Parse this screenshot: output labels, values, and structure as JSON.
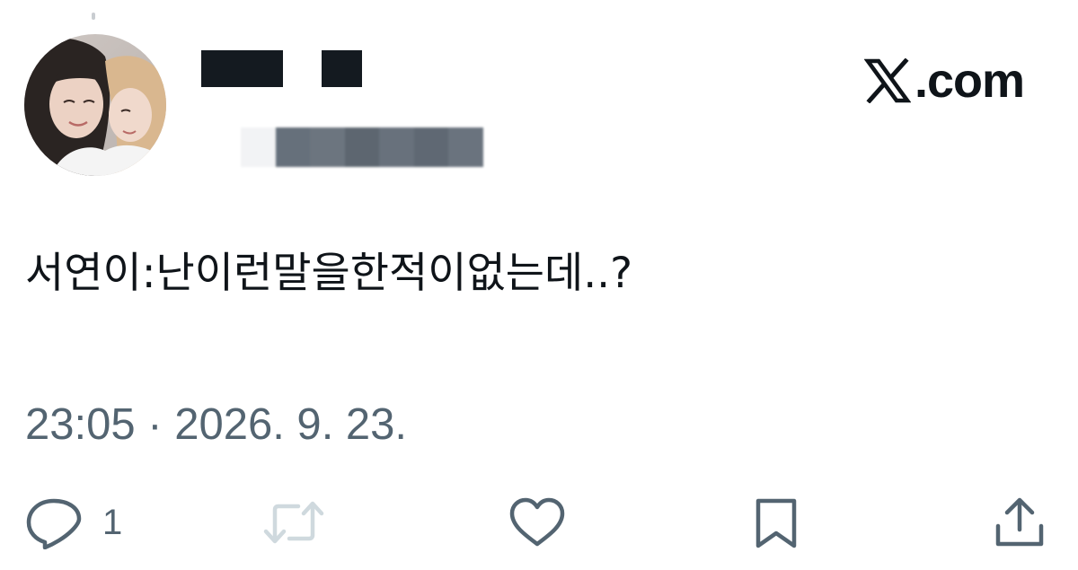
{
  "author": {
    "avatar_alt": "profile photo",
    "name_redacted": true,
    "handle_redacted": true
  },
  "brand": {
    "icon": "x-logo-icon",
    "label": ".com"
  },
  "tweet": {
    "text": "서연이:난이런말을한적이없는데..?",
    "time": "23:05",
    "separator": "·",
    "date": "2026. 9. 23."
  },
  "actions": {
    "reply": {
      "icon": "reply-bubble-icon",
      "count": "1"
    },
    "repost": {
      "icon": "repost-icon",
      "disabled": true
    },
    "like": {
      "icon": "heart-icon"
    },
    "bookmark": {
      "icon": "bookmark-icon"
    },
    "share": {
      "icon": "share-icon"
    }
  },
  "colors": {
    "text_primary": "#0f1419",
    "text_secondary": "#536471",
    "icon": "#536471",
    "icon_disabled": "#cfd9de",
    "redaction": "#141a20",
    "handle_blur": [
      "#f2f3f5",
      "#66707b",
      "#6c757f",
      "#5d6670",
      "#68717c",
      "#5f6873",
      "#6a737e"
    ]
  }
}
